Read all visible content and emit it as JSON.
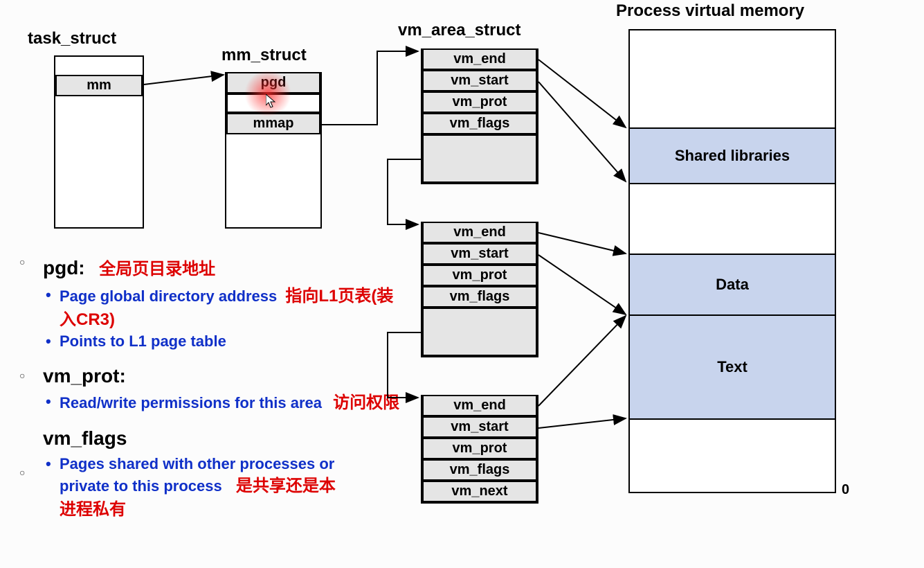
{
  "title_mem": "Process virtual memory",
  "task_struct": {
    "label": "task_struct",
    "field_mm": "mm"
  },
  "mm_struct": {
    "label": "mm_struct",
    "field_pgd": "pgd",
    "field_mmap": "mmap"
  },
  "vm_area": {
    "label": "vm_area_struct",
    "vm_end": "vm_end",
    "vm_start": "vm_start",
    "vm_prot": "vm_prot",
    "vm_flags": "vm_flags",
    "vm_next": "vm_next"
  },
  "memory": {
    "shared": "Shared libraries",
    "data": "Data",
    "text": "Text",
    "zero": "0"
  },
  "notes": {
    "pgd_title": "pgd:",
    "pgd_red1": "全局页目录地址",
    "pgd_l1": "Page global directory address",
    "pgd_red2": "指向L1页表(装入CR3)",
    "pgd_l2": "Points to L1 page table",
    "vmprot_title": "vm_prot:",
    "vmprot_l1": "Read/write permissions for this area",
    "vmprot_red": "访问权限",
    "vmflags_title": "vm_flags",
    "vmflags_l1": "Pages shared with other processes or private to this process",
    "vmflags_red": "是共享还是本进程私有"
  }
}
